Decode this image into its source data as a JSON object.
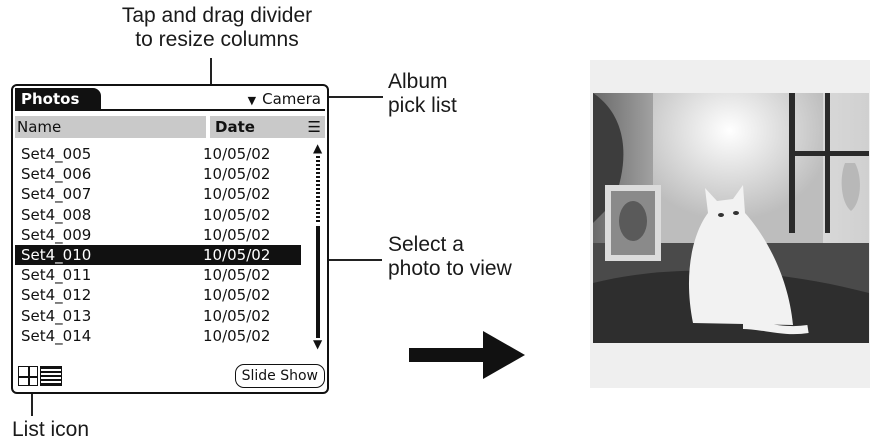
{
  "callouts": {
    "divider": "Tap and drag divider\nto resize columns",
    "album_line1": "Album",
    "album_line2": "pick list",
    "select_line1": "Select a",
    "select_line2": "photo to view",
    "list_icon": "List icon"
  },
  "app": {
    "title": "Photos",
    "album": "Camera",
    "columns": {
      "name": "Name",
      "date": "Date"
    },
    "rows": [
      {
        "name": "Set4_005",
        "date": "10/05/02"
      },
      {
        "name": "Set4_006",
        "date": "10/05/02"
      },
      {
        "name": "Set4_007",
        "date": "10/05/02"
      },
      {
        "name": "Set4_008",
        "date": "10/05/02"
      },
      {
        "name": "Set4_009",
        "date": "10/05/02"
      },
      {
        "name": "Set4_010",
        "date": "10/05/02",
        "selected": true
      },
      {
        "name": "Set4_011",
        "date": "10/05/02"
      },
      {
        "name": "Set4_012",
        "date": "10/05/02"
      },
      {
        "name": "Set4_013",
        "date": "10/05/02"
      },
      {
        "name": "Set4_014",
        "date": "10/05/02"
      }
    ],
    "slide_show": "Slide Show"
  },
  "icons": {
    "album_dropdown": "triangle-down-icon",
    "sort": "sort-lines-icon",
    "scroll_up": "arrow-up-icon",
    "scroll_down": "arrow-down-icon",
    "thumbnail_view": "grid-icon",
    "list_view": "list-icon",
    "flow": "arrow-right-icon"
  }
}
